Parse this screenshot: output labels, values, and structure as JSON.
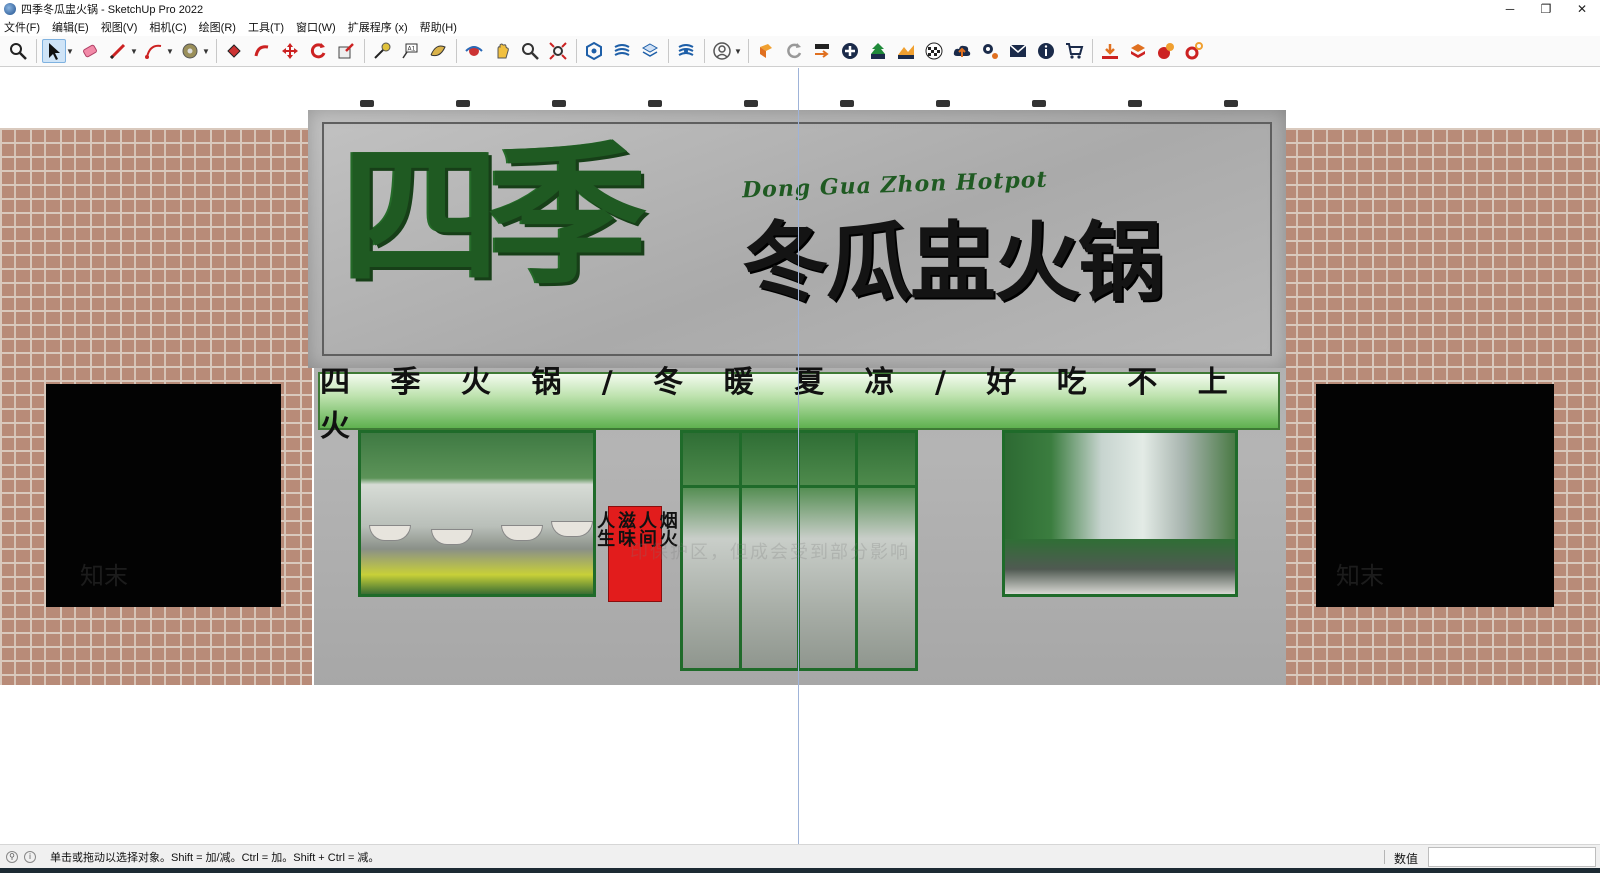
{
  "window": {
    "title": "四季冬瓜盅火锅 - SketchUp Pro 2022",
    "controls": {
      "minimize": "─",
      "restore": "❐",
      "close": "✕"
    }
  },
  "menu": [
    "文件(F)",
    "编辑(E)",
    "视图(V)",
    "相机(C)",
    "绘图(R)",
    "工具(T)",
    "窗口(W)",
    "扩展程序 (x)",
    "帮助(H)"
  ],
  "toolbar": {
    "groups": [
      [
        "search-icon"
      ],
      [
        "select-arrow-icon",
        "eraser-icon",
        "pencil-icon",
        "arc-icon",
        "tape-measure-icon"
      ],
      [
        "paint-bucket-icon",
        "push-pull-icon",
        "move-icon",
        "rotate-icon",
        "scale-icon"
      ],
      [
        "tape-icon",
        "text-label-icon",
        "section-plane-icon"
      ],
      [
        "orbit-icon",
        "pan-icon",
        "zoom-icon",
        "zoom-extents-icon"
      ],
      [
        "components-icon",
        "styles-icon",
        "layers-icon"
      ],
      [
        "scenes-icon"
      ],
      [
        "profile-icon"
      ],
      [
        "sketchup-logo-icon",
        "refresh-icon",
        "export-icon",
        "add-circle-icon",
        "tree-icon",
        "terrain-icon",
        "checker-icon",
        "cloud-upload-icon",
        "gear-icon",
        "mail-icon",
        "info-icon",
        "cart-icon"
      ],
      [
        "download-icon",
        "extension-warehouse-icon",
        "brush-icon",
        "settings-gear-icon"
      ]
    ],
    "accent": "#1e5fa8"
  },
  "scene": {
    "logo_big": "四季",
    "logo_name": "冬瓜盅火锅",
    "logo_english": "Dong Gua Zhon Hotpot",
    "slogan": "四 季 火 锅 / 冬 暖 夏 凉 / 好 吃 不 上 火",
    "poster_lines": [
      "烟火",
      "人间",
      "滋味",
      "人生"
    ],
    "watermark": "印保护区，但成会受到部分影响",
    "watermark_brand": "知末",
    "colors": {
      "logo_green": "#1f5a22",
      "slogan_green": "#5fb14f",
      "poster_red": "#e21c1c",
      "brick": "#b88b78",
      "frame_green": "#1f6b2a"
    }
  },
  "status": {
    "message": "单击或拖动以选择对象。Shift = 加/减。Ctrl = 加。Shift + Ctrl = 减。",
    "value_label": "数值",
    "value": ""
  }
}
